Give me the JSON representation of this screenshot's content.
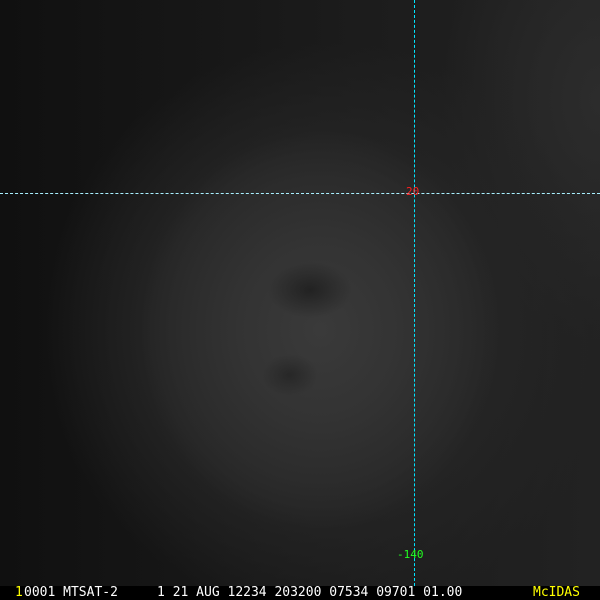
{
  "grid": {
    "latitude_label": "20",
    "longitude_label": "-140",
    "line_color": "#00e5ff",
    "lat_color": "#ff2020",
    "lon_color": "#20ff20"
  },
  "status_bar": {
    "frame_number": "1",
    "info": "0001 MTSAT-2     1 21 AUG 12234 203200 07534 09701 01.00",
    "brand": "McIDAS"
  }
}
